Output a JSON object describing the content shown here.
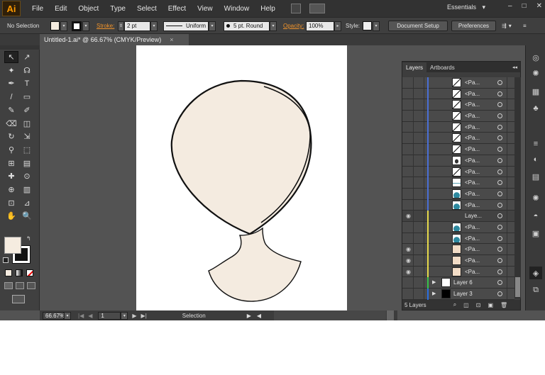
{
  "menubar": {
    "logo": "Ai",
    "items": [
      "File",
      "Edit",
      "Object",
      "Type",
      "Select",
      "Effect",
      "View",
      "Window",
      "Help"
    ],
    "workspace": "Essentials",
    "workspace_arrow": "▾",
    "controls": [
      "–",
      "□",
      "✕"
    ]
  },
  "control": {
    "selection_label": "No Selection",
    "stroke_label": "Stroke:",
    "stroke_value": "2 pt",
    "profile_value": "Uniform",
    "brush_value": "5 pt. Round",
    "opacity_label": "Opacity:",
    "opacity_value": "100%",
    "style_label": "Style:",
    "document_setup": "Document Setup",
    "preferences": "Preferences"
  },
  "document": {
    "tab_title": "Untitled-1.ai* @ 66.67% (CMYK/Preview)",
    "close": "×"
  },
  "status": {
    "zoom": "66.67%",
    "artboard": "1",
    "tool_status": "Selection"
  },
  "colors": {
    "fill": "#f5ece0",
    "stroke": "#000000",
    "artwork_fill": "#f4ebe0",
    "accent": "#f0932b"
  },
  "layers_panel": {
    "tabs": [
      "Layers",
      "Artboards"
    ],
    "footer": "5 Layers",
    "rows": [
      {
        "name": "<Pa...",
        "visible": false,
        "color": "#4a6fd4",
        "thumb": "curve"
      },
      {
        "name": "<Pa...",
        "visible": false,
        "color": "#4a6fd4",
        "thumb": "curve"
      },
      {
        "name": "<Pa...",
        "visible": false,
        "color": "#4a6fd4",
        "thumb": "curve"
      },
      {
        "name": "<Pa...",
        "visible": false,
        "color": "#4a6fd4",
        "thumb": "curve"
      },
      {
        "name": "<Pa...",
        "visible": false,
        "color": "#4a6fd4",
        "thumb": "curve"
      },
      {
        "name": "<Pa...",
        "visible": false,
        "color": "#4a6fd4",
        "thumb": "curve"
      },
      {
        "name": "<Pa...",
        "visible": false,
        "color": "#4a6fd4",
        "thumb": "curve"
      },
      {
        "name": "<Pa...",
        "visible": false,
        "color": "#4a6fd4",
        "thumb": "drop"
      },
      {
        "name": "<Pa...",
        "visible": false,
        "color": "#4a6fd4",
        "thumb": "curve"
      },
      {
        "name": "<Pa...",
        "visible": false,
        "color": "#4a6fd4",
        "thumb": "line"
      },
      {
        "name": "<Pa...",
        "visible": false,
        "color": "#4a6fd4",
        "thumb": "teal"
      },
      {
        "name": "<Pa...",
        "visible": false,
        "color": "#4a6fd4",
        "thumb": "teal"
      },
      {
        "name": "Laye...",
        "visible": true,
        "color": "#e5d84a",
        "thumb": "none"
      },
      {
        "name": "<Pa...",
        "visible": false,
        "color": "#e5d84a",
        "thumb": "teal"
      },
      {
        "name": "<Pa...",
        "visible": false,
        "color": "#e5d84a",
        "thumb": "teal"
      },
      {
        "name": "<Pa...",
        "visible": true,
        "color": "#e5d84a",
        "thumb": "skin"
      },
      {
        "name": "<Pa...",
        "visible": true,
        "color": "#e5d84a",
        "thumb": "skin"
      },
      {
        "name": "<Pa...",
        "visible": true,
        "color": "#e5d84a",
        "thumb": "skin"
      },
      {
        "name": "Layer 6",
        "visible": false,
        "color": "#38c24a",
        "thumb": "white",
        "layer": true
      },
      {
        "name": "Layer 3",
        "visible": false,
        "color": "#2a6fe0",
        "thumb": "black",
        "layer": true
      }
    ]
  },
  "glyphs": {
    "eye": "👁",
    "triangle": "▶",
    "dropdown": "▾"
  },
  "tools": [
    "↖",
    "↗",
    "✦",
    "☊",
    "✒",
    "T",
    "/",
    "▭",
    "✎",
    "✐",
    "⌫",
    "◫",
    "↻",
    "⇲",
    "⚲",
    "⬚",
    "⊞",
    "▤",
    "✚",
    "⊙",
    "⊕",
    "▥",
    "⊡",
    "⊿",
    "✋",
    "🔍"
  ],
  "dock_icons": [
    "◎",
    "✺",
    "▦",
    "♣",
    "≡",
    "◐",
    "▤",
    "✺",
    "◓",
    "▣",
    "◈",
    "⧉"
  ]
}
